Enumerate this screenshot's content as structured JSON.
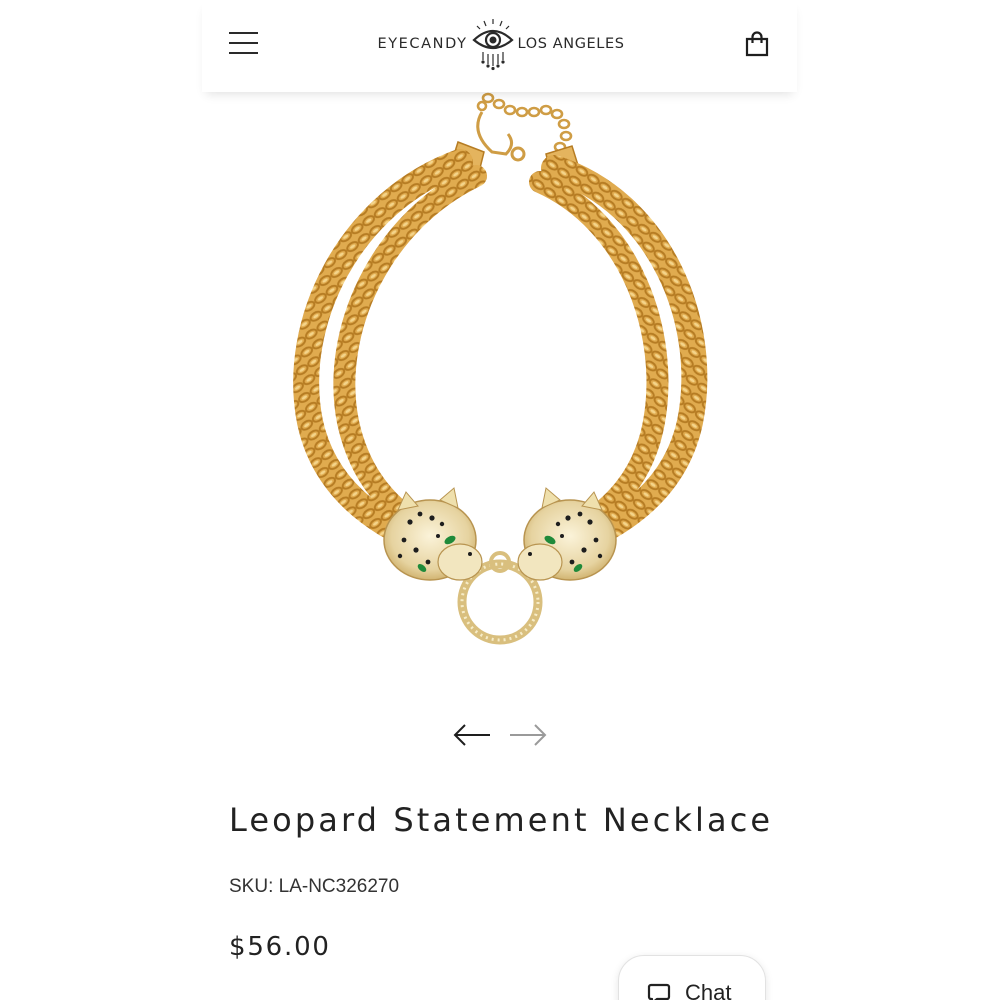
{
  "header": {
    "brand_left": "EYECANDY",
    "brand_right": "LOS ANGELES",
    "menu_icon": "hamburger-menu-icon",
    "cart_icon": "shopping-bag-icon"
  },
  "product": {
    "image_icon": "leopard-necklace-photo",
    "title": "Leopard Statement Necklace",
    "sku": "SKU: LA-NC326270",
    "price": "$56.00"
  },
  "carousel": {
    "prev_icon": "arrow-left-icon",
    "next_icon": "arrow-right-icon"
  },
  "chat": {
    "label": "Chat",
    "icon": "chat-bubble-icon"
  },
  "colors": {
    "gold": "#d4a24a",
    "text": "#222222",
    "arrow_disabled": "#9a9a9a"
  }
}
